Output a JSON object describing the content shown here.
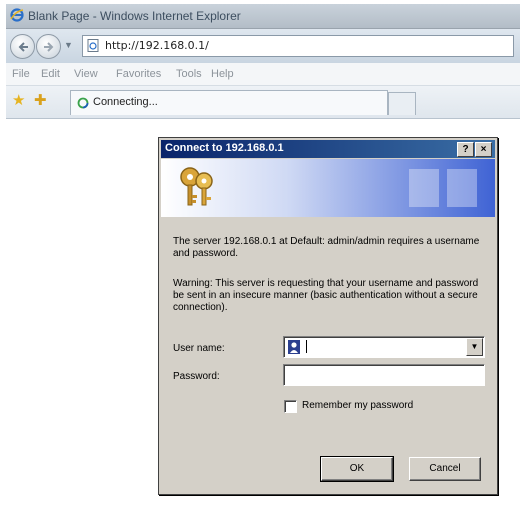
{
  "browser": {
    "window_title": "Blank Page - Windows Internet Explorer",
    "address": "http://192.168.0.1/",
    "menu": [
      "File",
      "Edit",
      "View",
      "Favorites",
      "Tools",
      "Help"
    ],
    "tab_label": "Connecting..."
  },
  "dialog": {
    "title": "Connect to 192.168.0.1",
    "help_label": "?",
    "close_label": "×",
    "server_message": "The server 192.168.0.1 at Default: admin/admin requires a username and password.",
    "warning_message": "Warning: This server is requesting that your username and password be sent in an insecure manner (basic authentication without a secure connection).",
    "username_label": "User name:",
    "username_value": "",
    "password_label": "Password:",
    "password_value": "",
    "remember_label": "Remember my password",
    "remember_checked": false,
    "ok_label": "OK",
    "cancel_label": "Cancel"
  },
  "icons": {
    "ie_logo": "ie-logo-icon",
    "back": "back-arrow-icon",
    "forward": "forward-arrow-icon",
    "page": "page-icon",
    "favorites": "star-icon",
    "add_favorites": "add-favorites-icon",
    "loading": "loading-spinner-icon",
    "keys": "keys-icon",
    "user": "user-icon",
    "dropdown": "chevron-down-icon"
  },
  "colors": {
    "dialog_title": "#0a246a",
    "dialog_face": "#d4d0c8",
    "banner_blue": "#3f63d4"
  }
}
